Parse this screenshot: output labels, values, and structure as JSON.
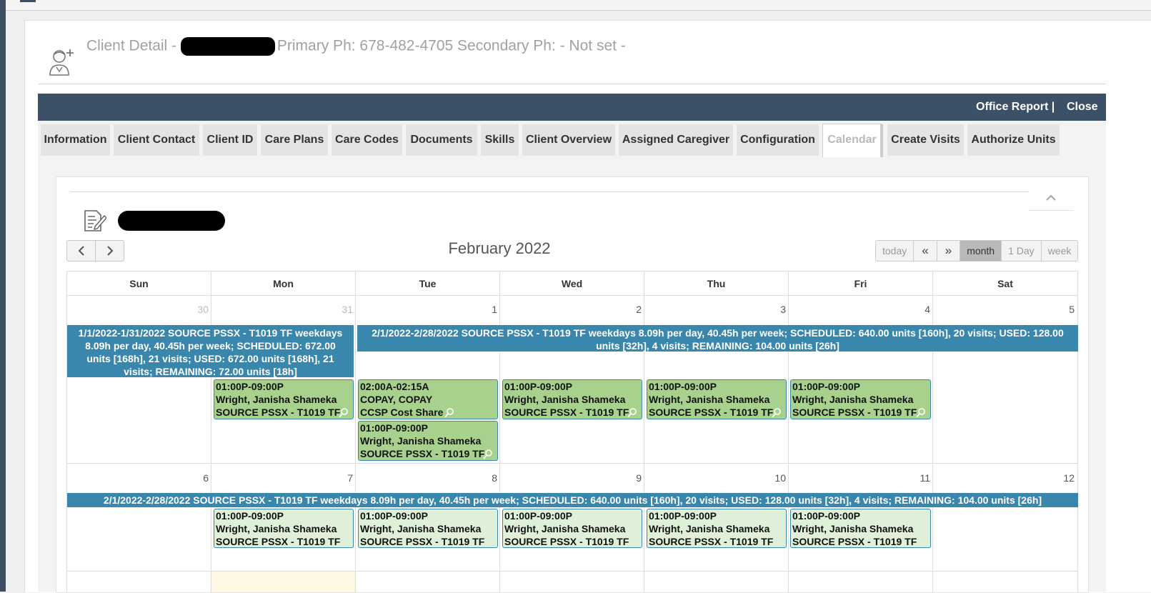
{
  "header": {
    "title_prefix": "Client Detail - ",
    "title_rest": "Primary Ph: 678-482-4705 Secondary Ph: - Not set -"
  },
  "actions": {
    "office_report": "Office Report |",
    "close": "Close"
  },
  "tabs": [
    {
      "label": "Information"
    },
    {
      "label": "Client Contact"
    },
    {
      "label": "Client ID"
    },
    {
      "label": "Care Plans"
    },
    {
      "label": "Care Codes"
    },
    {
      "label": "Documents"
    },
    {
      "label": "Skills"
    },
    {
      "label": "Client Overview"
    },
    {
      "label": "Assigned Caregiver"
    },
    {
      "label": "Configuration"
    },
    {
      "label": "Calendar",
      "active": true
    },
    {
      "label": "Create Visits"
    },
    {
      "label": "Authorize Units"
    }
  ],
  "calendar": {
    "title": "February 2022",
    "prev": "‹",
    "next": "›",
    "views": {
      "today": "today",
      "prev_year": "«",
      "next_year": "»",
      "month": "month",
      "day": "1 Day",
      "week": "week"
    },
    "day_headers": [
      "Sun",
      "Mon",
      "Tue",
      "Wed",
      "Thu",
      "Fri",
      "Sat"
    ],
    "week1_days": [
      "30",
      "31",
      "1",
      "2",
      "3",
      "4",
      "5"
    ],
    "week2_days": [
      "6",
      "7",
      "8",
      "9",
      "10",
      "11",
      "12"
    ],
    "band_jan": "1/1/2022-1/31/2022 SOURCE PSSX - T1019 TF weekdays 8.09h per day, 40.45h per week; SCHEDULED: 672.00 units [168h], 21 visits; USED: 672.00 units [168h], 21 visits; REMAINING: 72.00 units [18h]",
    "band_feb": "2/1/2022-2/28/2022 SOURCE PSSX - T1019 TF weekdays 8.09h per day, 40.45h per week; SCHEDULED: 640.00 units [160h], 20 visits; USED: 128.00 units [32h], 4 visits; REMAINING: 104.00 units [26h]",
    "visit": {
      "time": "01:00P-09:00P",
      "name": "Wright, Janisha Shameka",
      "code": "SOURCE PSSX - T1019 TF"
    },
    "copay": {
      "time": "02:00A-02:15A",
      "name": "COPAY, COPAY",
      "code": "CCSP Cost Share"
    }
  }
}
